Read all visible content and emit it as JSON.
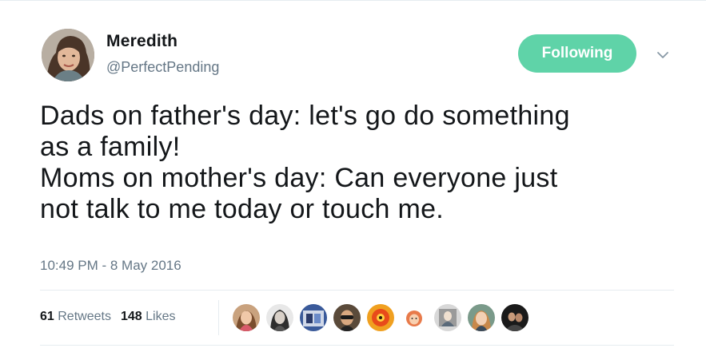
{
  "author": {
    "name": "Meredith",
    "handle": "@PerfectPending",
    "avatar_icon": "user-avatar-photo"
  },
  "follow_button": {
    "label": "Following",
    "color": "#5fd3a8"
  },
  "menu": {
    "icon": "chevron-down-icon"
  },
  "tweet": {
    "lines": [
      "Dads on father's day: let's go do something",
      "as a family!",
      "Moms on mother's day: Can everyone just",
      "not talk to me today or touch me."
    ],
    "timestamp": "10:49 PM - 8 May 2016"
  },
  "stats": {
    "retweets_count": "61",
    "retweets_label": "Retweets",
    "likes_count": "148",
    "likes_label": "Likes"
  },
  "likers": [
    {
      "icon": "liker-avatar-1"
    },
    {
      "icon": "liker-avatar-2"
    },
    {
      "icon": "liker-avatar-3"
    },
    {
      "icon": "liker-avatar-4"
    },
    {
      "icon": "liker-avatar-5"
    },
    {
      "icon": "liker-avatar-6"
    },
    {
      "icon": "liker-avatar-7"
    },
    {
      "icon": "liker-avatar-8"
    },
    {
      "icon": "liker-avatar-9"
    }
  ]
}
